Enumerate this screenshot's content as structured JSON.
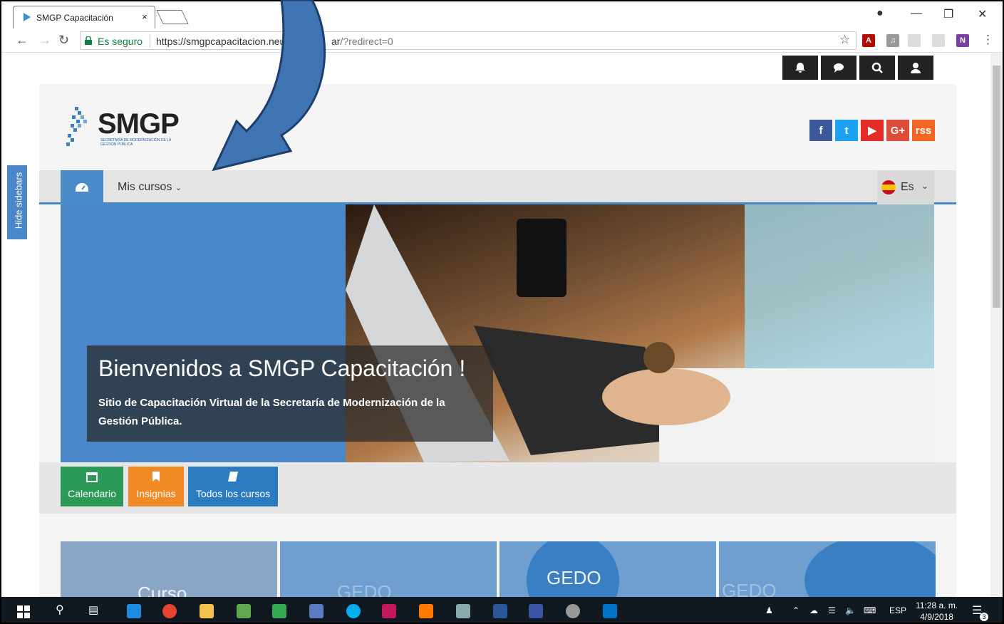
{
  "browser": {
    "tab_title": "SMGP Capacitación",
    "tab_close": "×",
    "secure_label": "Es seguro",
    "url_main": "https://smgpcapacitacion.neuquen.go",
    "url_mid": "ar",
    "url_query": "/?redirect=0"
  },
  "page": {
    "logo_text": "SMGP",
    "logo_sub": "SECRETARÍA DE MODERNIZACIÓN DE LA GESTIÓN PÚBLICA",
    "nav_label": "Mis cursos",
    "lang_label": "Es",
    "hide_sidebars": "Hide sidebars",
    "hero_title": "Bienvenidos a SMGP Capacitación !",
    "hero_text": "Sitio de Capacitación Virtual de la Secretaría de Modernización de la Gestión Pública.",
    "buttons": [
      {
        "label": "Calendario",
        "color": "#2a9a56"
      },
      {
        "label": "Insignias",
        "color": "#f08a24"
      },
      {
        "label": "Todos los cursos",
        "color": "#2b7bc0"
      }
    ],
    "social": [
      {
        "label": "f",
        "color": "#3b5998"
      },
      {
        "label": "t",
        "color": "#1da1f2"
      },
      {
        "label": "▶",
        "color": "#e52d27"
      },
      {
        "label": "G+",
        "color": "#dd4b39"
      },
      {
        "label": "rss",
        "color": "#f26522"
      }
    ],
    "cards": [
      {
        "text": "Curso"
      },
      {
        "text": "GEDO"
      },
      {
        "text": "GEDO"
      },
      {
        "text": "GEDO"
      }
    ]
  },
  "taskbar": {
    "lang": "ESP",
    "time": "11:28 a. m.",
    "date": "4/9/2018",
    "notif_count": "3"
  }
}
